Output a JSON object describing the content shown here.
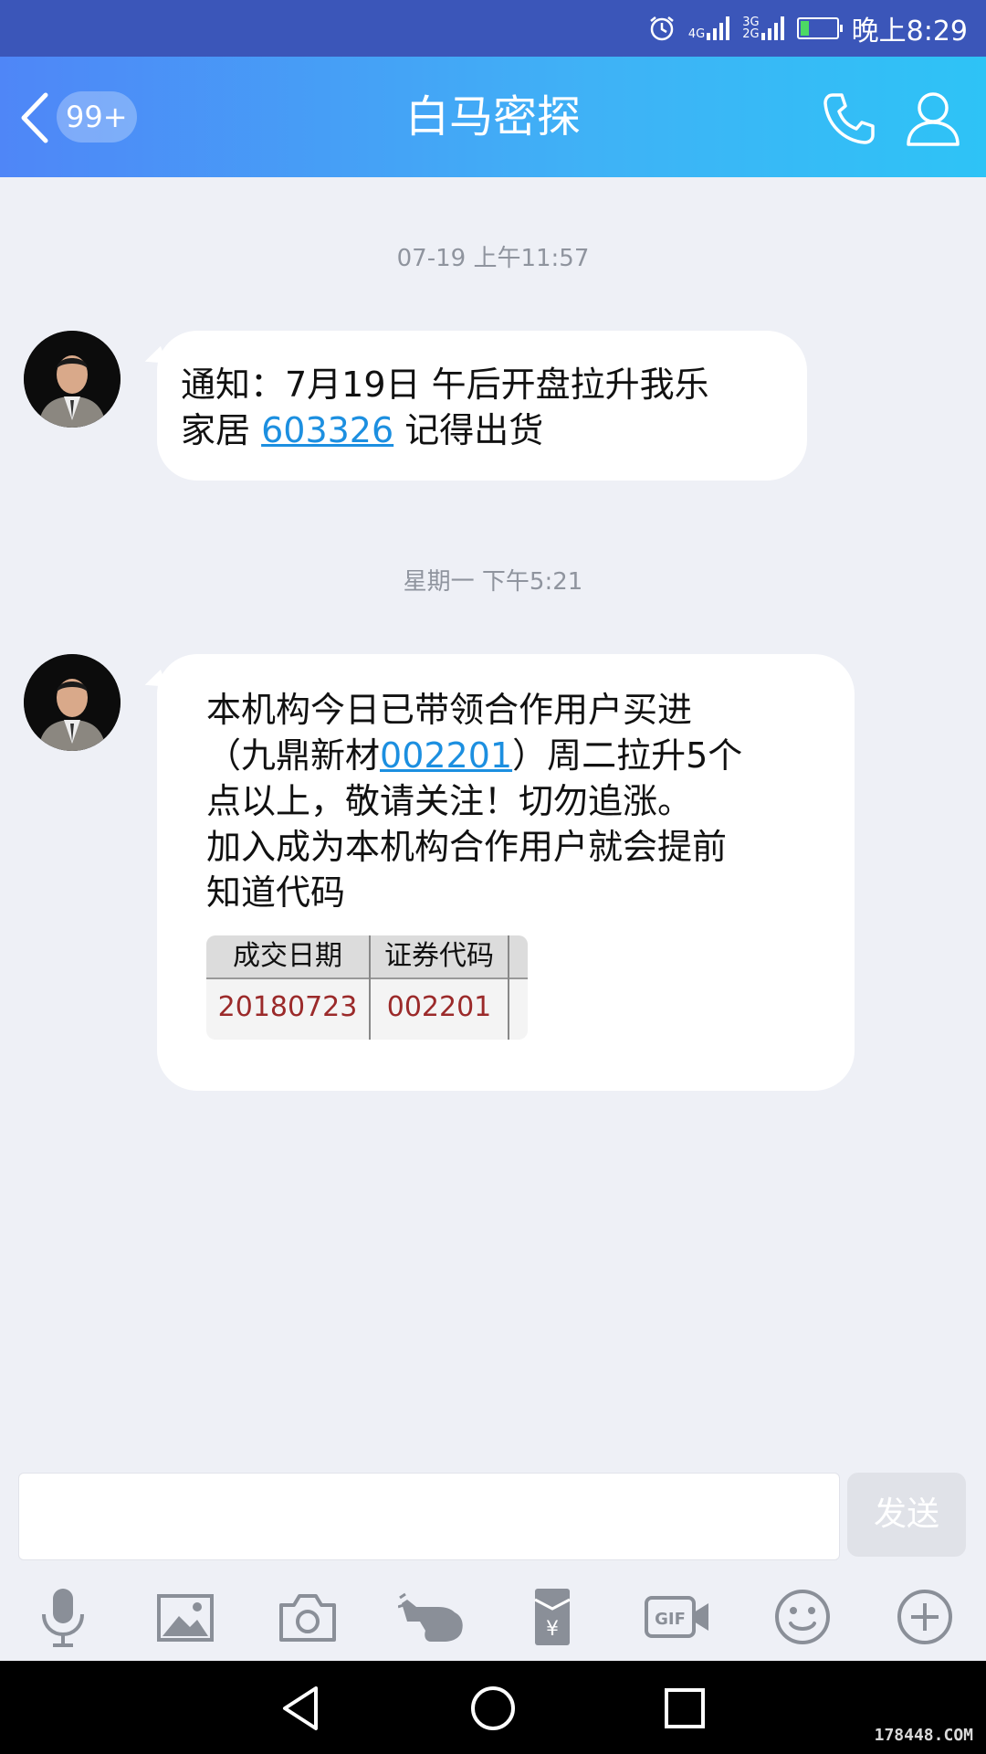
{
  "status_bar": {
    "time": "晚上8:29",
    "network_1": "4G",
    "network_2": "3G\n2G",
    "icons": [
      "alarm-icon",
      "signal-icon",
      "signal-icon",
      "battery-icon"
    ]
  },
  "header": {
    "unread_badge": "99+",
    "title": "白马密探",
    "icons": [
      "back-icon",
      "phone-icon",
      "profile-icon"
    ]
  },
  "messages": [
    {
      "timestamp": "07-19 上午11:57",
      "lines": [
        {
          "text": "通知：7月19日  午后开盘拉升我乐"
        },
        {
          "prefix": "家居 ",
          "link": "603326",
          "suffix": "  记得出货"
        }
      ]
    },
    {
      "timestamp": "星期一 下午5:21",
      "lines": [
        {
          "text": "本机构今日已带领合作用户买进"
        },
        {
          "prefix": "（九鼎新材",
          "link": "002201",
          "suffix": "）周二拉升5个"
        },
        {
          "text": "点以上，敬请关注！切勿追涨。"
        },
        {
          "text": "加入成为本机构合作用户就会提前"
        },
        {
          "text": "知道代码"
        }
      ],
      "table": {
        "headers": [
          "成交日期",
          "证券代码"
        ],
        "row": [
          "20180723",
          "002201"
        ]
      }
    }
  ],
  "composer": {
    "input_value": "",
    "send_label": "发送"
  },
  "toolbar": [
    "microphone-icon",
    "image-icon",
    "camera-icon",
    "poke-icon",
    "red-packet-icon",
    "gif-icon",
    "emoji-icon",
    "plus-icon"
  ],
  "navbar": [
    "back-nav-icon",
    "home-nav-icon",
    "recents-nav-icon"
  ],
  "watermark": "178448.COM"
}
